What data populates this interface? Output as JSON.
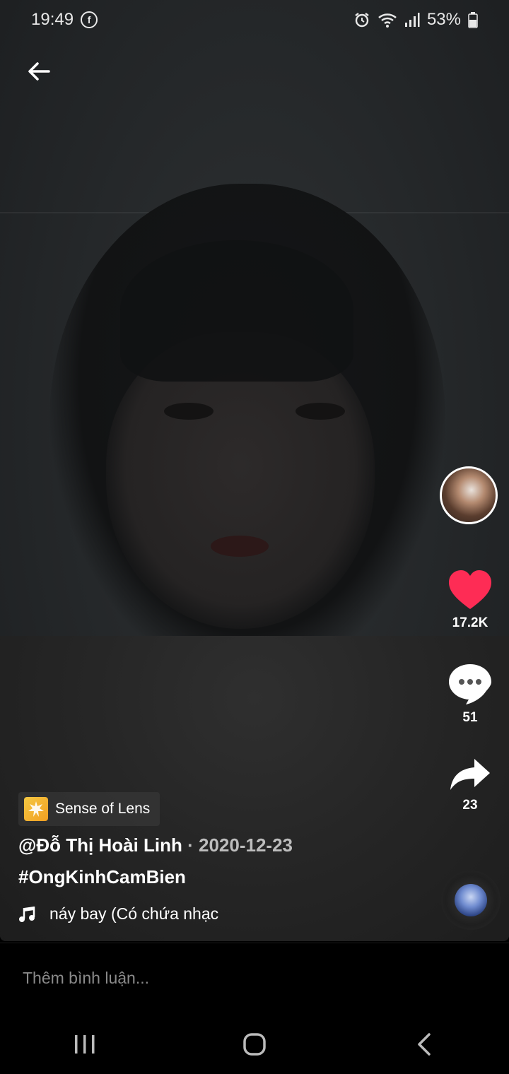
{
  "status_bar": {
    "time": "19:49",
    "notification_icon": "facebook-icon",
    "battery": "53%",
    "icons": [
      "alarm-icon",
      "wifi-icon",
      "signal-icon",
      "battery-icon"
    ]
  },
  "header": {
    "back_icon": "back-arrow-icon"
  },
  "sidebar": {
    "like_count": "17.2K",
    "comment_count": "51",
    "share_count": "23",
    "like_color": "#fe2c55"
  },
  "effect": {
    "label": "Sense of Lens"
  },
  "post": {
    "author": "@Đỗ Thị Hoài Linh",
    "separator": " · ",
    "date": "2020-12-23",
    "hashtag": "#OngKinhCamBien",
    "music": "náy bay (Có chứa nhạc"
  },
  "comment": {
    "placeholder": "Thêm bình luận..."
  },
  "nav": {
    "icons": [
      "recent-apps-icon",
      "home-icon",
      "back-icon"
    ]
  }
}
